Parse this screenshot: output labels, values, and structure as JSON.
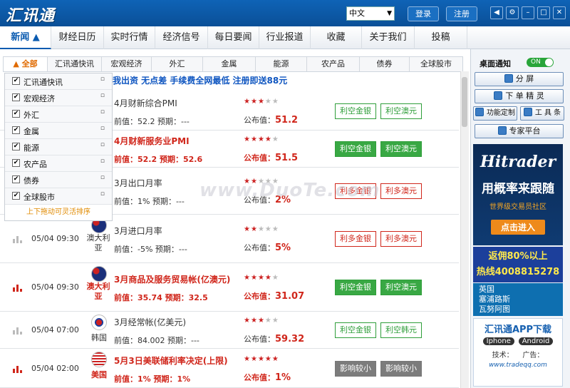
{
  "app": {
    "logo": "汇讯通"
  },
  "titlebar": {
    "language": "中文",
    "login_label": "登录",
    "register_label": "注册"
  },
  "nav": {
    "tabs": [
      "新闻 ▲",
      "财经日历",
      "实时行情",
      "经济信号",
      "每日要闻",
      "行业报道",
      "收藏",
      "关于我们",
      "投稿"
    ]
  },
  "categories": [
    "▲ 全部",
    "汇讯通快讯",
    "宏观经济",
    "外汇",
    "金属",
    "能源",
    "农产品",
    "债券",
    "全球股市"
  ],
  "dropdown": {
    "items": [
      "汇讯通快讯",
      "宏观经济",
      "外汇",
      "金属",
      "能源",
      "农产品",
      "债券",
      "全球股市"
    ],
    "footer": "上下拖动可灵活排序"
  },
  "banner": "我出资 无点差 手续费全网最低 注册即送88元",
  "rows": [
    {
      "date": "",
      "country": "",
      "flag": "",
      "name": "4月财新综合PMI",
      "prev": "前值：52.2 预期：---",
      "stars": "★★★★★",
      "stars_on": 3,
      "pub_label": "公布值：",
      "pub": "51.2",
      "tag1": "利空金银",
      "tag2": "利空澳元",
      "style": "green-o"
    },
    {
      "date": "",
      "country": "",
      "flag": "",
      "name": "4月财新服务业PMI",
      "prev": "前值：52.2 预期：52.6",
      "stars": "★★★★★",
      "stars_on": 4,
      "pub_label": "公布值：",
      "pub": "51.5",
      "tag1": "利空金银",
      "tag2": "利空澳元",
      "style": "green-f"
    },
    {
      "date": "",
      "country": "",
      "flag": "",
      "name": "3月出口月率",
      "prev": "前值：1% 预期：---",
      "stars": "★★★★★",
      "stars_on": 2,
      "pub_label": "公布值：",
      "pub": "2%",
      "tag1": "利多金银",
      "tag2": "利多澳元",
      "style": "red-o"
    },
    {
      "date": "05/04 09:30",
      "country": "澳大利亚",
      "flag": "au",
      "name": "3月进口月率",
      "prev": "前值：-5% 预期：---",
      "stars": "★★★★★",
      "stars_on": 2,
      "pub_label": "公布值：",
      "pub": "5%",
      "tag1": "利多金银",
      "tag2": "利多澳元",
      "style": "red-o"
    },
    {
      "date": "05/04 09:30",
      "country": "澳大利亚",
      "flag": "au",
      "name": "3月商品及服务贸易帐(亿澳元)",
      "prev": "前值：35.74 预期：32.5",
      "stars": "★★★★★",
      "stars_on": 4,
      "pub_label": "公布值：",
      "pub": "31.07",
      "tag1": "利空金银",
      "tag2": "利空澳元",
      "style": "green-f"
    },
    {
      "date": "05/04 07:00",
      "country": "韩国",
      "flag": "kr",
      "name": "3月经常帐(亿美元)",
      "prev": "前值：84.002 预期：---",
      "stars": "★★★★★",
      "stars_on": 3,
      "pub_label": "公布值：",
      "pub": "59.32",
      "tag1": "利空金银",
      "tag2": "利空韩元",
      "style": "green-o"
    },
    {
      "date": "05/04 02:00",
      "country": "美国",
      "flag": "us",
      "name": "5月3日美联储利率决定(上限)",
      "prev": "前值：1% 预期：1%",
      "stars": "★★★★★",
      "stars_on": 5,
      "pub_label": "公布值：",
      "pub": "1%",
      "tag1": "影响较小",
      "tag2": "影响较小",
      "style": "gray-f"
    }
  ],
  "side": {
    "toggle_label": "桌面通知",
    "toggle_state": "ON",
    "split_label": "分 屏",
    "order_label": "下 单 精 灵",
    "custom_label": "功能定制",
    "tools_label": "工 具 条",
    "expert_label": "专家平台"
  },
  "ads": {
    "hitrader": {
      "brand": "Hitrader",
      "slogan": "用概率来跟随",
      "sub": "世界级交易员社区",
      "cta": "点击进入"
    },
    "rebate": {
      "line1": "返佣80%以上",
      "line2": "热线4008815278"
    },
    "map": {
      "line1": "英国",
      "line2": "塞浦路斯",
      "line3": "瓦努阿图"
    },
    "app": {
      "title": "汇讯通APP下载",
      "ios": "Iphone",
      "android": "Android",
      "tech": "技术：",
      "adv": "广告：",
      "url": "www.tradeqq.com"
    }
  },
  "watermark": "www.DuoTe.com",
  "colors": {
    "titlebar": "#0b5bb0",
    "accent_red": "#d0261b",
    "accent_green": "#39a844",
    "accent_orange": "#e06a00"
  }
}
